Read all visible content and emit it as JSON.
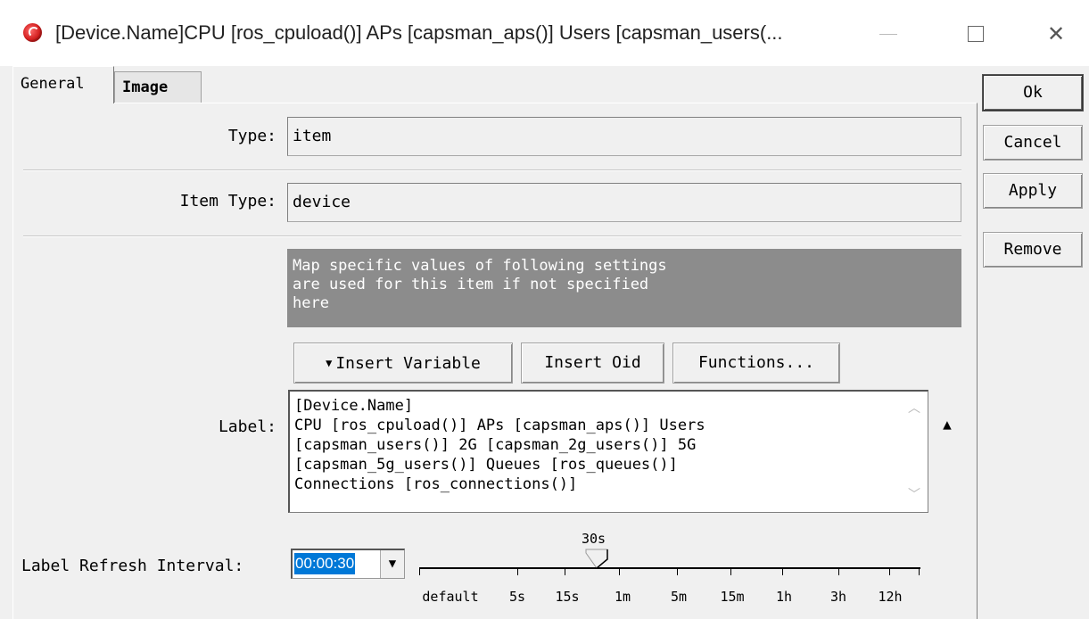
{
  "window": {
    "title": "[Device.Name]CPU [ros_cpuload()] APs [capsman_aps()] Users [capsman_users(...",
    "icon": "mikrotik-dude-icon"
  },
  "tabs": [
    {
      "label": "General",
      "active": true
    },
    {
      "label": "Image",
      "active": false
    }
  ],
  "form": {
    "type_label": "Type:",
    "type_value": "item",
    "item_type_label": "Item Type:",
    "item_type_value": "device",
    "note": "Map specific values of following settings\nare used for this item if not specified\nhere",
    "insert_variable": "Insert Variable",
    "insert_oid": "Insert Oid",
    "functions": "Functions...",
    "label_label": "Label:",
    "label_value": "[Device.Name]\nCPU [ros_cpuload()] APs [capsman_aps()] Users\n[capsman_users()] 2G [capsman_2g_users()] 5G\n[capsman_5g_users()] Queues [ros_queues()]\nConnections [ros_connections()]",
    "refresh_label": "Label Refresh Interval:",
    "refresh_value": "00:00:30",
    "slider_current": "30s",
    "slider_ticks": [
      "default",
      "5s",
      "15s",
      "1m",
      "5m",
      "15m",
      "1h",
      "3h",
      "12h"
    ]
  },
  "buttons": {
    "ok": "Ok",
    "cancel": "Cancel",
    "apply": "Apply",
    "remove": "Remove"
  }
}
